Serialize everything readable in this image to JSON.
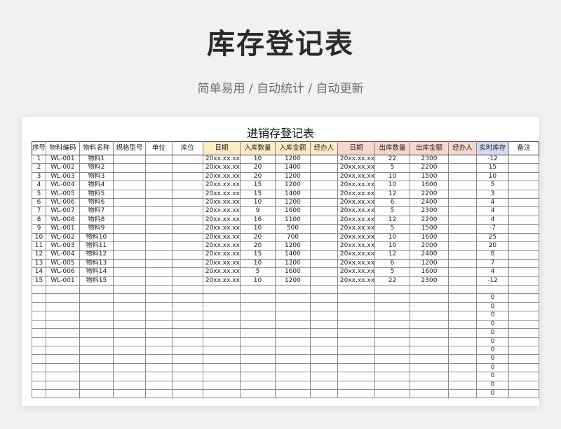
{
  "page": {
    "title": "库存登记表",
    "subtitle": "简单易用 / 自动统计 / 自动更新"
  },
  "sheet": {
    "title": "进销存登记表",
    "headers": [
      "序号",
      "物料编码",
      "物料名称",
      "规格型号",
      "单位",
      "库位",
      "日期",
      "入库数量",
      "入库金额",
      "经办人",
      "日期",
      "出库数量",
      "出库金额",
      "经办人",
      "实时库存",
      "备注"
    ],
    "rows": [
      [
        "1",
        "WL-001",
        "物料1",
        "",
        "",
        "",
        "20xx.xx.xx",
        "10",
        "1200",
        "",
        "20xx.xx.xx",
        "22",
        "2300",
        "",
        "-12",
        ""
      ],
      [
        "2",
        "WL-002",
        "物料2",
        "",
        "",
        "",
        "20xx.xx.xx",
        "20",
        "1400",
        "",
        "20xx.xx.xx",
        "5",
        "2200",
        "",
        "15",
        ""
      ],
      [
        "3",
        "WL-003",
        "物料3",
        "",
        "",
        "",
        "20xx.xx.xx",
        "20",
        "1200",
        "",
        "20xx.xx.xx",
        "10",
        "1500",
        "",
        "10",
        ""
      ],
      [
        "4",
        "WL-004",
        "物料4",
        "",
        "",
        "",
        "20xx.xx.xx",
        "15",
        "1200",
        "",
        "20xx.xx.xx",
        "10",
        "1600",
        "",
        "5",
        ""
      ],
      [
        "5",
        "WL-005",
        "物料5",
        "",
        "",
        "",
        "20xx.xx.xx",
        "15",
        "1400",
        "",
        "20xx.xx.xx",
        "12",
        "2200",
        "",
        "3",
        ""
      ],
      [
        "6",
        "WL-006",
        "物料6",
        "",
        "",
        "",
        "20xx.xx.xx",
        "10",
        "1200",
        "",
        "20xx.xx.xx",
        "6",
        "2400",
        "",
        "4",
        ""
      ],
      [
        "7",
        "WL-007",
        "物料7",
        "",
        "",
        "",
        "20xx.xx.xx",
        "9",
        "1600",
        "",
        "20xx.xx.xx",
        "5",
        "2300",
        "",
        "4",
        ""
      ],
      [
        "8",
        "WL-008",
        "物料8",
        "",
        "",
        "",
        "20xx.xx.xx",
        "16",
        "1100",
        "",
        "20xx.xx.xx",
        "12",
        "2200",
        "",
        "4",
        ""
      ],
      [
        "9",
        "WL-001",
        "物料9",
        "",
        "",
        "",
        "20xx.xx.xx",
        "10",
        "500",
        "",
        "20xx.xx.xx",
        "5",
        "1500",
        "",
        "-7",
        ""
      ],
      [
        "10",
        "WL-002",
        "物料10",
        "",
        "",
        "",
        "20xx.xx.xx",
        "20",
        "700",
        "",
        "20xx.xx.xx",
        "10",
        "1600",
        "",
        "25",
        ""
      ],
      [
        "11",
        "WL-003",
        "物料11",
        "",
        "",
        "",
        "20xx.xx.xx",
        "20",
        "1200",
        "",
        "20xx.xx.xx",
        "10",
        "2000",
        "",
        "20",
        ""
      ],
      [
        "12",
        "WL-004",
        "物料12",
        "",
        "",
        "",
        "20xx.xx.xx",
        "15",
        "1400",
        "",
        "20xx.xx.xx",
        "12",
        "2400",
        "",
        "8",
        ""
      ],
      [
        "13",
        "WL-005",
        "物料13",
        "",
        "",
        "",
        "20xx.xx.xx",
        "10",
        "1200",
        "",
        "20xx.xx.xx",
        "6",
        "1200",
        "",
        "7",
        ""
      ],
      [
        "14",
        "WL-006",
        "物料14",
        "",
        "",
        "",
        "20xx.xx.xx",
        "5",
        "1600",
        "",
        "20xx.xx.xx",
        "5",
        "1600",
        "",
        "4",
        ""
      ],
      [
        "15",
        "WL-001",
        "物料15",
        "",
        "",
        "",
        "20xx.xx.xx",
        "10",
        "1200",
        "",
        "20xx.xx.xx",
        "22",
        "2300",
        "",
        "-12",
        ""
      ],
      [
        "",
        "",
        "",
        "",
        "",
        "",
        "",
        "",
        "",
        "",
        "",
        "",
        "",
        "",
        "",
        ""
      ],
      [
        "",
        "",
        "",
        "",
        "",
        "",
        "",
        "",
        "",
        "",
        "",
        "",
        "",
        "",
        "0",
        ""
      ],
      [
        "",
        "",
        "",
        "",
        "",
        "",
        "",
        "",
        "",
        "",
        "",
        "",
        "",
        "",
        "0",
        ""
      ],
      [
        "",
        "",
        "",
        "",
        "",
        "",
        "",
        "",
        "",
        "",
        "",
        "",
        "",
        "",
        "0",
        ""
      ],
      [
        "",
        "",
        "",
        "",
        "",
        "",
        "",
        "",
        "",
        "",
        "",
        "",
        "",
        "",
        "0",
        ""
      ],
      [
        "",
        "",
        "",
        "",
        "",
        "",
        "",
        "",
        "",
        "",
        "",
        "",
        "",
        "",
        "0",
        ""
      ],
      [
        "",
        "",
        "",
        "",
        "",
        "",
        "",
        "",
        "",
        "",
        "",
        "",
        "",
        "",
        "0",
        ""
      ],
      [
        "",
        "",
        "",
        "",
        "",
        "",
        "",
        "",
        "",
        "",
        "",
        "",
        "",
        "",
        "0",
        ""
      ],
      [
        "",
        "",
        "",
        "",
        "",
        "",
        "",
        "",
        "",
        "",
        "",
        "",
        "",
        "",
        "0",
        ""
      ],
      [
        "",
        "",
        "",
        "",
        "",
        "",
        "",
        "",
        "",
        "",
        "",
        "",
        "",
        "",
        "0",
        ""
      ],
      [
        "",
        "",
        "",
        "",
        "",
        "",
        "",
        "",
        "",
        "",
        "",
        "",
        "",
        "",
        "0",
        ""
      ],
      [
        "",
        "",
        "",
        "",
        "",
        "",
        "",
        "",
        "",
        "",
        "",
        "",
        "",
        "",
        "0",
        ""
      ],
      [
        "",
        "",
        "",
        "",
        "",
        "",
        "",
        "",
        "",
        "",
        "",
        "",
        "",
        "",
        "0",
        ""
      ]
    ]
  },
  "colors": {
    "inbound_header": "#fdebc2",
    "outbound_header": "#f7d7cc",
    "stock_header": "#d2daf0"
  }
}
